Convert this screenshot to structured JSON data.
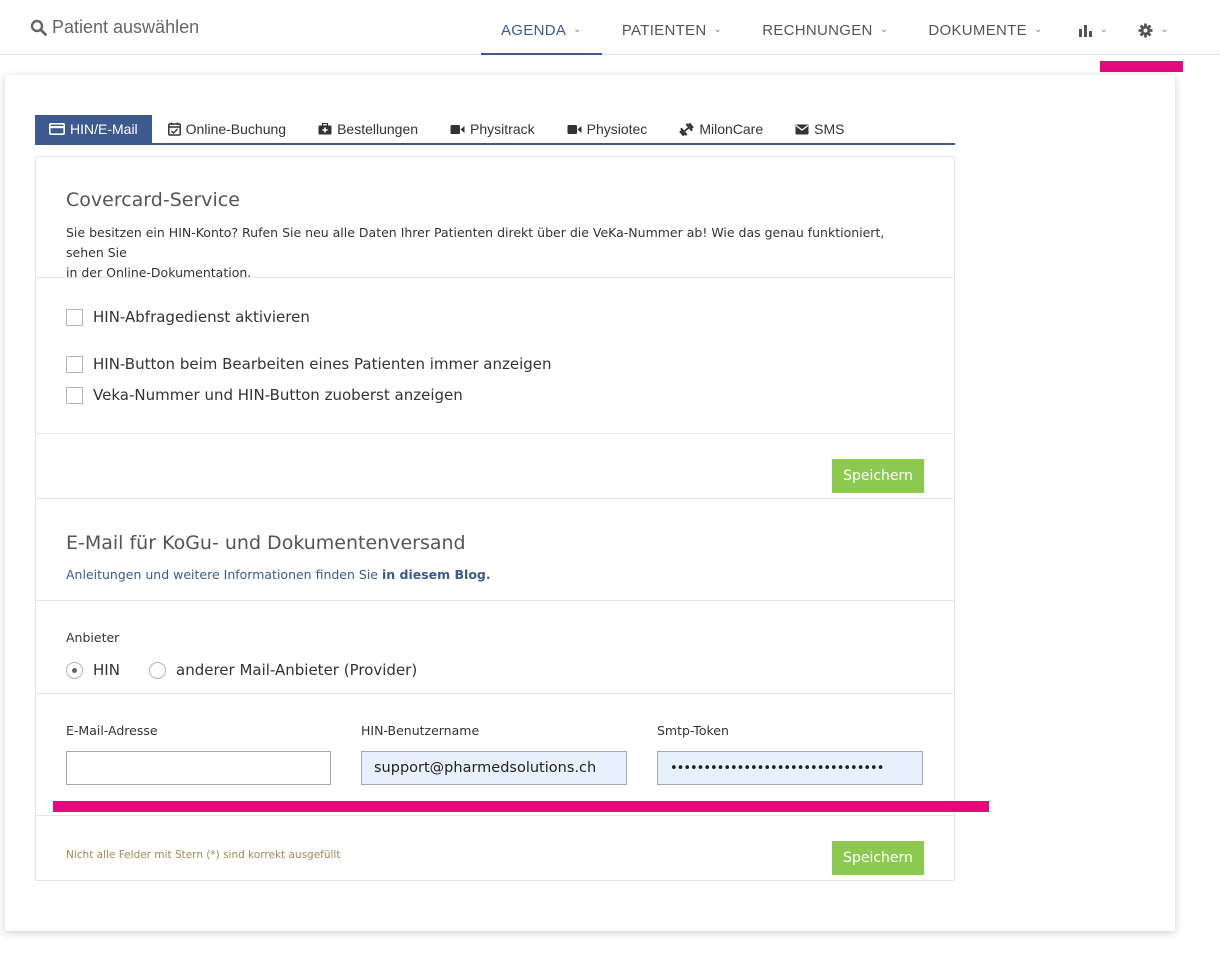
{
  "search": {
    "label": "Patient auswählen"
  },
  "nav": {
    "items": [
      {
        "label": "AGENDA",
        "active": true
      },
      {
        "label": "PATIENTEN"
      },
      {
        "label": "RECHNUNGEN"
      },
      {
        "label": "DOKUMENTE"
      }
    ],
    "chevron": "⌄",
    "icons": [
      "bar-chart-icon",
      "gear-icon"
    ]
  },
  "tabs": [
    {
      "label": "HIN/E-Mail",
      "icon": "credit-card-icon",
      "active": true
    },
    {
      "label": "Online-Buchung",
      "icon": "calendar-check-icon"
    },
    {
      "label": "Bestellungen",
      "icon": "medkit-icon"
    },
    {
      "label": "Physitrack",
      "icon": "video-camera-icon"
    },
    {
      "label": "Physiotec",
      "icon": "video-camera-icon"
    },
    {
      "label": "MilonCare",
      "icon": "dumbbell-icon"
    },
    {
      "label": "SMS",
      "icon": "envelope-icon"
    }
  ],
  "covercard": {
    "title": "Covercard-Service",
    "description_line1": "Sie besitzen ein HIN-Konto? Rufen Sie neu alle Daten Ihrer Patienten direkt über die VeKa-Nummer ab! Wie das genau funktioniert, sehen Sie",
    "description_line2": "in der Online-Dokumentation.",
    "checkboxes": [
      {
        "label": "HIN-Abfragedienst aktivieren",
        "checked": false
      },
      {
        "label": "HIN-Button beim Bearbeiten eines Patienten immer anzeigen",
        "checked": false
      },
      {
        "label": "Veka-Nummer und HIN-Button zuoberst anzeigen",
        "checked": false
      }
    ],
    "save_label": "Speichern"
  },
  "email": {
    "title": "E-Mail für KoGu- und Dokumentenversand",
    "info_prefix": "Anleitungen und weitere Informationen finden Sie ",
    "info_link": "in diesem Blog.",
    "provider_label": "Anbieter",
    "providers": [
      {
        "label": "HIN",
        "selected": true
      },
      {
        "label": "anderer Mail-Anbieter (Provider)",
        "selected": false
      }
    ],
    "fields": {
      "email_label": "E-Mail-Adresse",
      "email_value": "",
      "hin_user_label": "HIN-Benutzername",
      "hin_user_value": "support@pharmedsolutions.ch",
      "smtp_label": "Smtp-Token",
      "smtp_value": "••••••••••••••••••••••••••••••••"
    },
    "footer_note": "Nicht alle Felder mit Stern (*) sind korrekt ausgefüllt",
    "save_label": "Speichern"
  },
  "colors": {
    "accent": "#3d5a8f",
    "save_button": "#8cc94f",
    "highlight": "#e6087d",
    "autofill": "#e8f0fe"
  }
}
